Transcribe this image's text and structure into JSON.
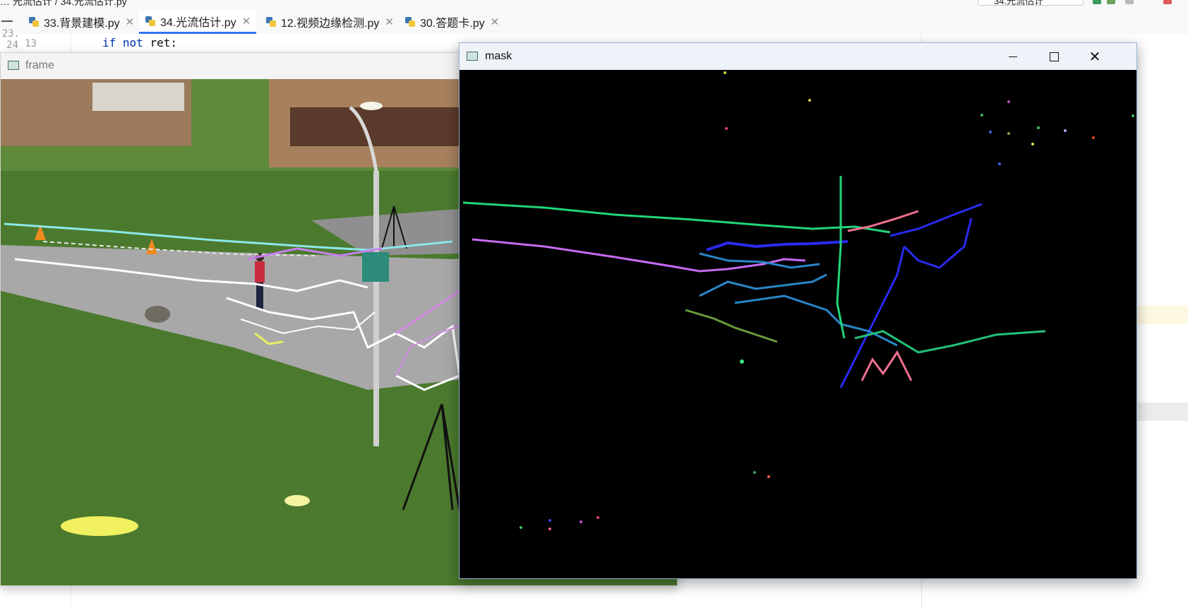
{
  "topbar": {
    "breadcrumb": "…  光流估计 / 34.光流估计.py",
    "run_config": "34.光流估计"
  },
  "tabs": [
    {
      "label": "33.背景建模.py",
      "active": false
    },
    {
      "label": "34.光流估计.py",
      "active": true
    },
    {
      "label": "12.视频边缘检测.py",
      "active": false
    },
    {
      "label": "30.答题卡.py",
      "active": false
    }
  ],
  "editor": {
    "line_numbers": [
      "23.",
      "24",
      "13"
    ],
    "code_line": {
      "keyword1": "if",
      "keyword2": "not",
      "rest": " ret:"
    }
  },
  "windows": {
    "frame": {
      "title": "frame"
    },
    "mask": {
      "title": "mask",
      "controls": {
        "minimize": "minimize-icon",
        "maximize": "maximize-icon",
        "close": "close-icon"
      }
    }
  },
  "icons": {
    "window": "opencv-window-icon",
    "python_file": "python-file-icon"
  },
  "colors": {
    "accent": "#3574f0",
    "mask_background": "#000000",
    "grass": "#4b7a2e",
    "road": "#a9a9a9"
  }
}
